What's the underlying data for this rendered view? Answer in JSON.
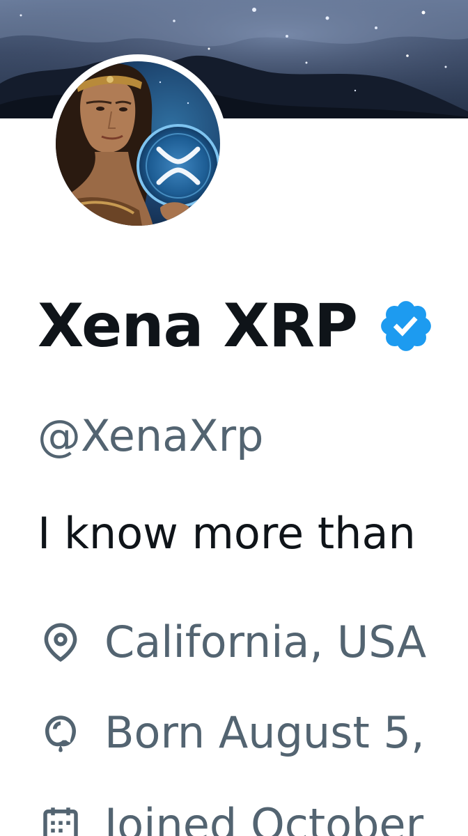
{
  "profile": {
    "display_name": "Xena XRP",
    "verified": true,
    "handle": "@XenaXrp",
    "bio": "I know more than",
    "location": "California, USA",
    "birthday": "Born August 5,",
    "joined": "Joined October"
  },
  "icons": {
    "verified": "verified-badge-icon",
    "location": "location-pin-icon",
    "birthday": "balloon-icon",
    "joined": "calendar-icon"
  },
  "colors": {
    "text_primary": "#0f1419",
    "text_secondary": "#536471",
    "verified_blue": "#1d9bf0",
    "background": "#ffffff"
  }
}
